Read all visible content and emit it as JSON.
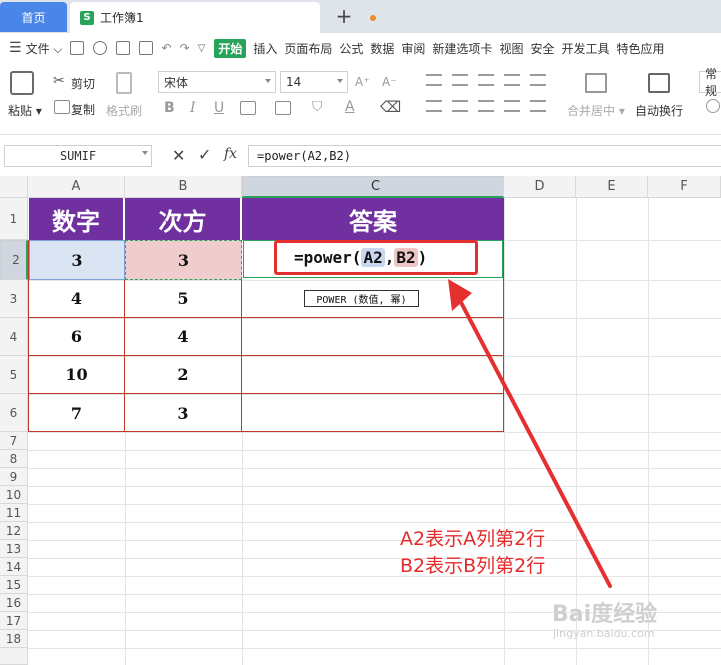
{
  "tabs": {
    "home_label": "首页",
    "doc_title": "工作簿1",
    "doc_icon_letter": "S",
    "new_tab_label": "+"
  },
  "menu": {
    "file_label": "文件",
    "items": [
      "开始",
      "插入",
      "页面布局",
      "公式",
      "数据",
      "审阅",
      "新建选项卡",
      "视图",
      "安全",
      "开发工具",
      "特色应用"
    ],
    "active_item": "开始"
  },
  "ribbon": {
    "paste_label": "粘贴",
    "cut_label": "剪切",
    "copy_label": "复制",
    "format_painter_label": "格式刷",
    "font_name": "宋体",
    "font_size": "14",
    "bold_label": "B",
    "italic_label": "I",
    "underline_label": "U",
    "merge_label": "合并居中",
    "wrap_label": "自动换行",
    "number_format_label": "常规"
  },
  "formula_bar": {
    "name_box": "SUMIF",
    "fx_label": "fx",
    "formula": "=power(A2,B2)"
  },
  "grid": {
    "columns": [
      "A",
      "B",
      "C",
      "D",
      "E",
      "F"
    ],
    "selected_column": "C",
    "rows": [
      "1",
      "2",
      "3",
      "4",
      "5",
      "6",
      "7",
      "8",
      "9",
      "10",
      "11",
      "12",
      "13",
      "14",
      "15",
      "16",
      "17",
      "18"
    ],
    "selected_row": "2",
    "headers": [
      "数字",
      "次方",
      "答案"
    ],
    "data": [
      [
        "3",
        "3",
        ""
      ],
      [
        "4",
        "5",
        ""
      ],
      [
        "6",
        "4",
        ""
      ],
      [
        "10",
        "2",
        ""
      ],
      [
        "7",
        "3",
        ""
      ]
    ]
  },
  "editing": {
    "formula_prefix": "=power(",
    "ref_a": "A2",
    "separator": ",",
    "ref_b": "B2",
    "formula_suffix": ")",
    "tooltip": "POWER (数值, 幂)"
  },
  "annotation": {
    "line1": "A2表示A列第2行",
    "line2": "B2表示B列第2行",
    "color": "#e52b2b"
  },
  "watermark": {
    "text": "Bai度经验",
    "sub": "jingyan.baidu.com"
  }
}
